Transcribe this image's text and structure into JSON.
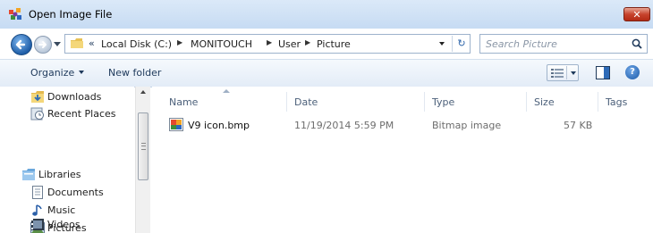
{
  "window": {
    "title": "Open Image File"
  },
  "address": {
    "overflow": "«",
    "crumbs": [
      "Local Disk (C:)",
      "MONITOUCH",
      "User",
      "Picture"
    ]
  },
  "search": {
    "placeholder": "Search Picture"
  },
  "toolbar": {
    "organize": "Organize",
    "new_folder": "New folder"
  },
  "sidebar": {
    "items": [
      {
        "label": "Downloads",
        "icon": "downloads-folder-icon"
      },
      {
        "label": "Recent Places",
        "icon": "recent-places-icon"
      },
      {
        "label": "Libraries",
        "icon": "libraries-icon"
      },
      {
        "label": "Documents",
        "icon": "documents-icon"
      },
      {
        "label": "Music",
        "icon": "music-icon"
      },
      {
        "label": "Pictures",
        "icon": "pictures-icon"
      },
      {
        "label": "Videos",
        "icon": "videos-icon"
      }
    ]
  },
  "columns": [
    "Name",
    "Date",
    "Type",
    "Size",
    "Tags"
  ],
  "files": [
    {
      "name": "V9 icon.bmp",
      "date": "11/19/2014 5:59 PM",
      "type": "Bitmap image",
      "size": "57 KB",
      "tags": ""
    }
  ],
  "colors": {
    "close_button": "#c7442e",
    "accent": "#1f5ea8",
    "header_text": "#4c607a"
  }
}
